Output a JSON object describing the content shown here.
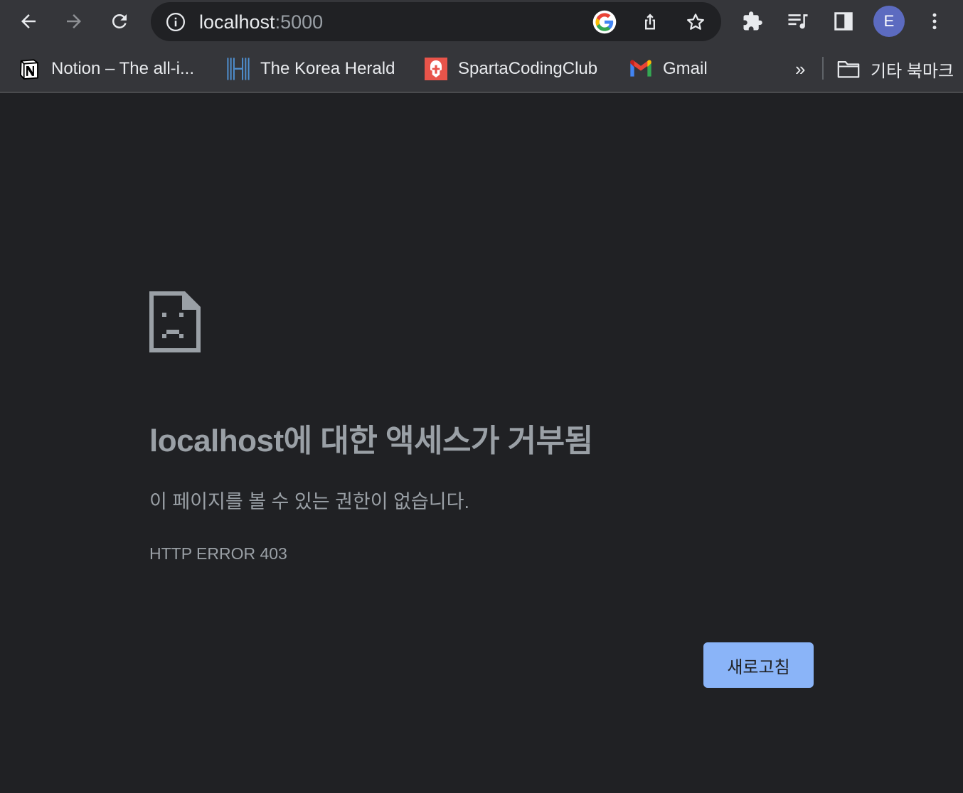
{
  "browser": {
    "url_host": "localhost",
    "url_port": ":5000",
    "avatar_letter": "E",
    "icons": {
      "back": "back-arrow-icon",
      "forward": "forward-arrow-icon",
      "reload": "reload-icon",
      "site_info": "info-icon",
      "google": "google-icon",
      "share": "share-icon",
      "bookmark": "star-icon",
      "extensions": "puzzle-icon",
      "media": "media-queue-icon",
      "side_panel": "side-panel-icon",
      "menu": "kebab-menu-icon"
    }
  },
  "bookmarks": {
    "items": [
      {
        "label": "Notion – The all-i...",
        "icon": "notion-icon"
      },
      {
        "label": "The Korea Herald",
        "icon": "korea-herald-icon"
      },
      {
        "label": "SpartaCodingClub",
        "icon": "sparta-icon"
      },
      {
        "label": "Gmail",
        "icon": "gmail-icon"
      }
    ],
    "overflow_label": "»",
    "other_folder_label": "기타 북마크"
  },
  "error_page": {
    "title": "localhost에 대한 액세스가 거부됨",
    "description": "이 페이지를 볼 수 있는 권한이 없습니다.",
    "code": "HTTP ERROR 403",
    "reload_label": "새로고침",
    "accent_color": "#8ab4f8"
  }
}
